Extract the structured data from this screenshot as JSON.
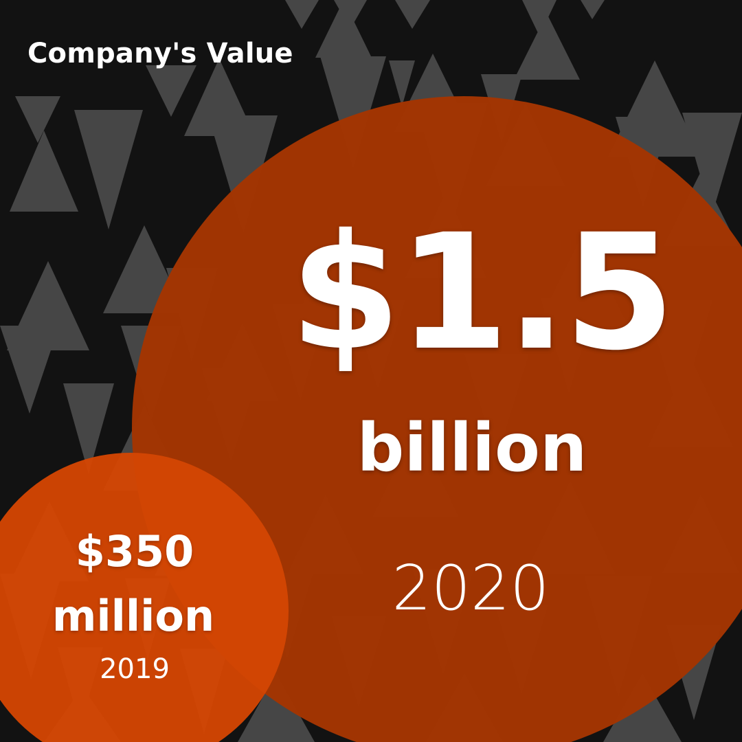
{
  "title": "Company's Value",
  "large_circle": {
    "value": "$1.5",
    "unit": "billion",
    "year": "2020"
  },
  "small_circle": {
    "value": "$350",
    "unit": "million",
    "year": "2019"
  },
  "colors": {
    "background": "#121212",
    "large_circle": "#a33502",
    "small_circle": "#d34603",
    "text": "#ffffff",
    "pattern": "#ffffff"
  }
}
